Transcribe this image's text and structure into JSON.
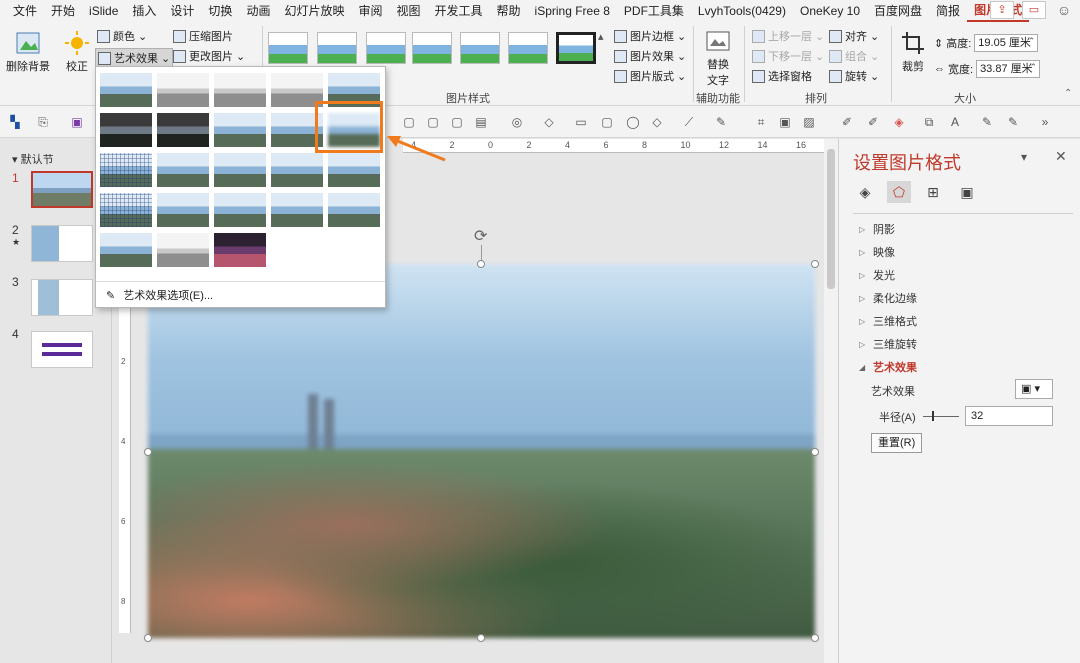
{
  "ribbon_tabs": [
    "文件",
    "开始",
    "iSlide",
    "插入",
    "设计",
    "切换",
    "动画",
    "幻灯片放映",
    "审阅",
    "视图",
    "开发工具",
    "帮助",
    "iSpring Free 8",
    "PDF工具集",
    "LvyhTools(0429)",
    "OneKey 10",
    "百度网盘",
    "简报",
    "图片格式"
  ],
  "active_tab": "图片格式",
  "ribbon": {
    "remove_bg": "删除背景",
    "correct": "校正",
    "color": "颜色",
    "art_effect": "艺术效果",
    "compress": "压缩图片",
    "change_pic": "更改图片",
    "pic_border": "图片边框",
    "pic_effect": "图片效果",
    "pic_layout": "图片版式",
    "group_pic_style": "图片样式",
    "alt_text": "替换文字",
    "group_aux": "辅助功能",
    "bring_forward": "上移一层",
    "send_backward": "下移一层",
    "selection_pane": "选择窗格",
    "align": "对齐",
    "group": "组合",
    "rotate": "旋转",
    "group_arrange": "排列",
    "crop": "裁剪",
    "height_label": "高度:",
    "height_value": "19.05 厘米",
    "width_label": "宽度:",
    "width_value": "33.87 厘米",
    "group_size": "大小"
  },
  "ruler_ticks": [
    "4",
    "2",
    "0",
    "2",
    "4",
    "6",
    "8",
    "10",
    "12",
    "14",
    "16"
  ],
  "vruler_ticks": [
    "2",
    "4",
    "6",
    "8"
  ],
  "slides_panel": {
    "section": "默认节",
    "slides": [
      {
        "num": "1",
        "star": ""
      },
      {
        "num": "2",
        "star": "★"
      },
      {
        "num": "3",
        "star": ""
      },
      {
        "num": "4",
        "star": ""
      }
    ]
  },
  "art_gallery": {
    "options_label": "艺术效果选项(E)..."
  },
  "format_pane": {
    "title": "设置图片格式",
    "sections": [
      "阴影",
      "映像",
      "发光",
      "柔化边缘",
      "三维格式",
      "三维旋转"
    ],
    "open_section": "艺术效果",
    "effect_label": "艺术效果",
    "radius_label": "半径(A)",
    "radius_value": "32",
    "reset_label": "重置(R)"
  },
  "colors": {
    "accent": "#c0392b",
    "highlight": "#f07a1c"
  }
}
